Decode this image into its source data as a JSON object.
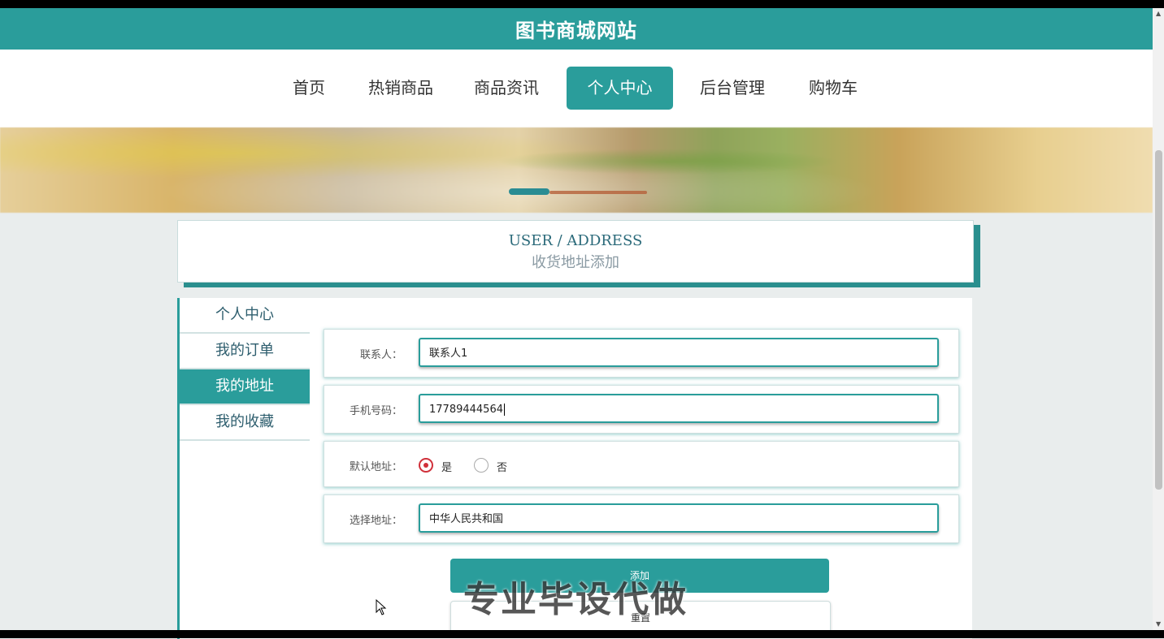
{
  "header": {
    "title": "图书商城网站"
  },
  "nav": {
    "items": [
      {
        "label": "首页"
      },
      {
        "label": "热销商品"
      },
      {
        "label": "商品资讯"
      },
      {
        "label": "个人中心"
      },
      {
        "label": "后台管理"
      },
      {
        "label": "购物车"
      }
    ],
    "active": "个人中心"
  },
  "page_title": {
    "en": "USER / ADDRESS",
    "cn": "收货地址添加"
  },
  "sidebar": {
    "items": [
      {
        "label": "个人中心"
      },
      {
        "label": "我的订单"
      },
      {
        "label": "我的地址"
      },
      {
        "label": "我的收藏"
      }
    ],
    "active": "我的地址"
  },
  "form": {
    "contact": {
      "label": "联系人：",
      "value": "联系人1"
    },
    "phone": {
      "label": "手机号码：",
      "value": "17789444564"
    },
    "default": {
      "label": "默认地址：",
      "yes": "是",
      "no": "否",
      "selected": "是"
    },
    "address": {
      "label": "选择地址：",
      "value": "中华人民共和国"
    },
    "add_button": "添加",
    "reset_button": "重置"
  },
  "watermark": "专业毕设代做",
  "colors": {
    "accent": "#2a9d9b",
    "radio": "#d0303a"
  }
}
